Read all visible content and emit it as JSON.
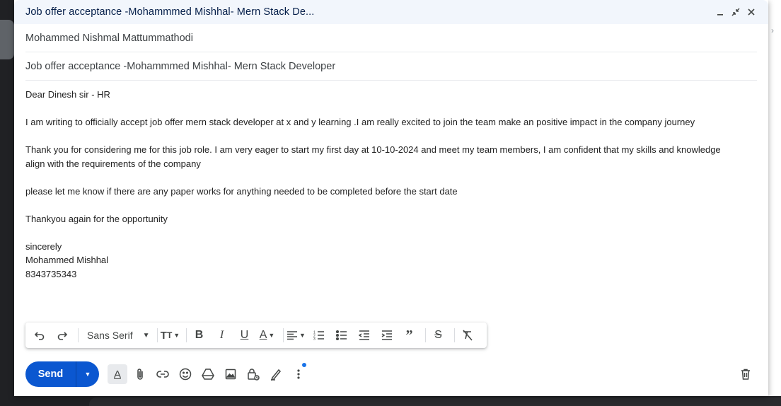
{
  "compose": {
    "title": "Job offer acceptance -Mohammmed Mishhal- Mern Stack De...",
    "to": "Mohammed Nishmal Mattummathodi",
    "subject": "Job offer acceptance -Mohammmed Mishhal- Mern Stack Developer"
  },
  "body": {
    "greeting": "Dear Dinesh sir - HR",
    "para1": "I am writing  to officially accept job offer mern stack developer at x and y learning .I am really excited to join the team make an positive impact in the company journey",
    "para2": "Thank you  for considering  me for this job role. I am very eager to start my first day at 10-10-2024 and meet my team members, I am confident that my skills and knowledge align with the requirements  of the company",
    "para3": "please let me know if there are any paper works for anything needed to be completed before the start date",
    "para4": "Thankyou again for the opportunity",
    "closing": "sincerely",
    "name": "Mohammed Mishhal",
    "phone": "8343735343"
  },
  "toolbar": {
    "font": "Sans Serif"
  },
  "actions": {
    "send_label": "Send"
  },
  "colors": {
    "send": "#0b57d0",
    "title_bar": "#f2f6fc",
    "notification_dot": "#1a73e8"
  }
}
